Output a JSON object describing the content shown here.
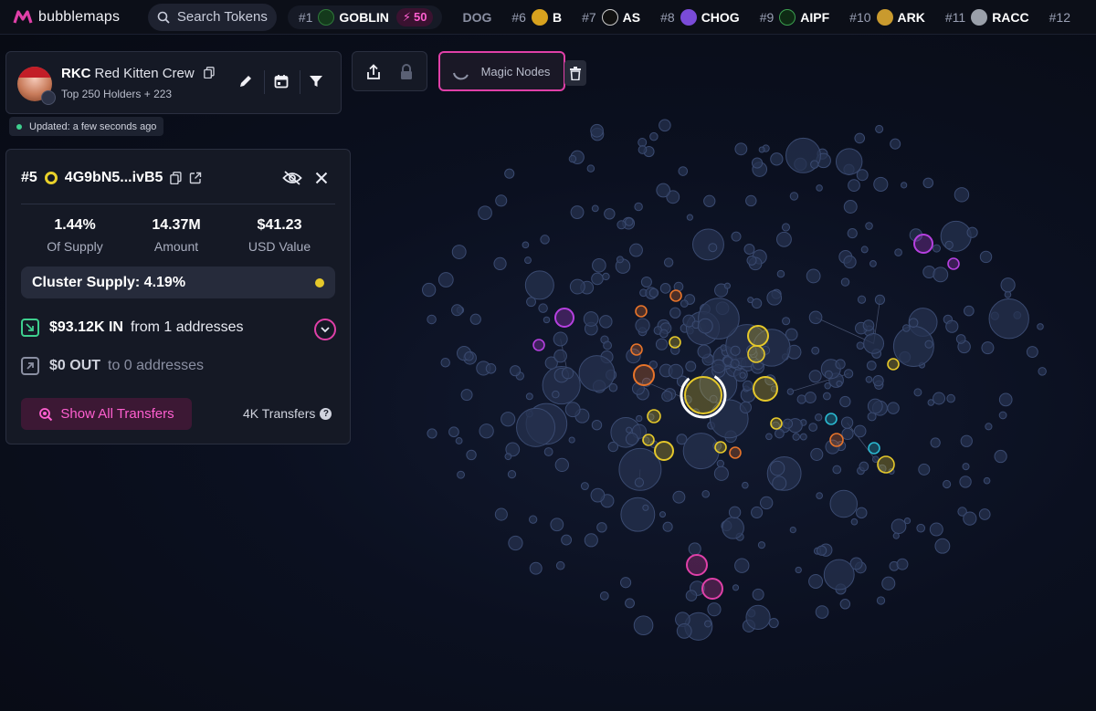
{
  "app": {
    "name": "bubblemaps"
  },
  "search": {
    "label": "Search Tokens"
  },
  "ticker": [
    {
      "rank": "#1",
      "name": "GOBLIN",
      "boost": "50",
      "icon": "goblin-token-icon",
      "color": "#2f7a3a"
    },
    {
      "rank": "",
      "name": "DOG",
      "icon": "dog-token-icon",
      "color": "#555"
    },
    {
      "rank": "#6",
      "name": "B",
      "icon": "b-token-icon",
      "color": "#d8a21e"
    },
    {
      "rank": "#7",
      "name": "AS",
      "icon": "as-token-icon",
      "color": "#222"
    },
    {
      "rank": "#8",
      "name": "CHOG",
      "icon": "chog-token-icon",
      "color": "#7a4bd8"
    },
    {
      "rank": "#9",
      "name": "AIPF",
      "icon": "aipf-token-icon",
      "color": "#1c5a2a"
    },
    {
      "rank": "#10",
      "name": "ARK",
      "icon": "ark-token-icon",
      "color": "#c99a2e"
    },
    {
      "rank": "#11",
      "name": "RACC",
      "icon": "racc-token-icon",
      "color": "#9aa0aa"
    },
    {
      "rank": "#12",
      "name": "",
      "icon": "",
      "color": "#444"
    }
  ],
  "token": {
    "symbol": "RKC",
    "name": "Red Kitten Crew",
    "subtitle": "Top 250 Holders + 223",
    "updated": "Updated: a few seconds ago"
  },
  "toolbar": {
    "magic_nodes": "Magic Nodes"
  },
  "detail": {
    "rank": "#5",
    "address": "4G9bN5...ivB5",
    "stats": [
      {
        "value": "1.44%",
        "label": "Of Supply"
      },
      {
        "value": "14.37M",
        "label": "Amount"
      },
      {
        "value": "$41.23",
        "label": "USD Value"
      }
    ],
    "cluster_supply": "Cluster Supply: 4.19%",
    "in_amount": "$93.12K IN",
    "in_text": "from 1 addresses",
    "out_amount": "$0 OUT",
    "out_text": "to 0 addresses",
    "show_all": "Show All Transfers",
    "transfers": "4K Transfers"
  },
  "colors": {
    "accent": "#e040a8",
    "highlight": "#e5c82a",
    "orange": "#e8742a",
    "purple": "#b640e0",
    "cyan": "#2ab8d0",
    "node": "#2a3658"
  }
}
